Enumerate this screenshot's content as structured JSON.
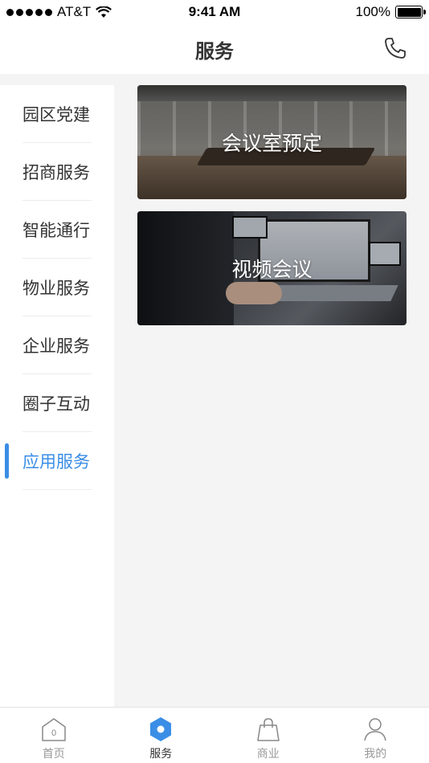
{
  "status_bar": {
    "carrier": "AT&T",
    "time": "9:41 AM",
    "battery": "100%"
  },
  "header": {
    "title": "服务",
    "phone_icon": "phone-icon"
  },
  "sidebar": {
    "active_index": 6,
    "accent_color": "#3a8ee6",
    "items": [
      {
        "label": "园区党建"
      },
      {
        "label": "招商服务"
      },
      {
        "label": "智能通行"
      },
      {
        "label": "物业服务"
      },
      {
        "label": "企业服务"
      },
      {
        "label": "圈子互动"
      },
      {
        "label": "应用服务"
      }
    ]
  },
  "cards": [
    {
      "label": "会议室预定",
      "image": "conference-room-photo"
    },
    {
      "label": "视频会议",
      "image": "video-meeting-photo"
    }
  ],
  "tab_bar": {
    "active_index": 1,
    "active_color": "#3a8ee6",
    "items": [
      {
        "label": "首页",
        "icon": "home-icon"
      },
      {
        "label": "服务",
        "icon": "service-hexagon-icon"
      },
      {
        "label": "商业",
        "icon": "shopping-bag-icon"
      },
      {
        "label": "我的",
        "icon": "profile-icon"
      }
    ]
  }
}
